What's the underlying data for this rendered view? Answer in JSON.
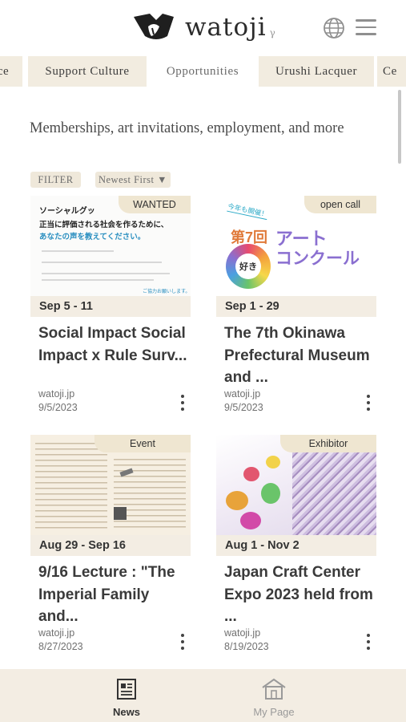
{
  "header": {
    "brand": "watoji",
    "brand_sup": "γ"
  },
  "tabs": [
    {
      "label": "ce"
    },
    {
      "label": "Support Culture"
    },
    {
      "label": "Opportunities"
    },
    {
      "label": "Urushi Lacquer"
    },
    {
      "label": "Ce"
    }
  ],
  "page": {
    "subtitle": "Memberships, art invitations, employment, and more"
  },
  "filters": {
    "filter_label": "FILTER",
    "sort_label": "Newest First ▼"
  },
  "cards": [
    {
      "badge": "WANTED",
      "date_range": "Sep 5 - 11",
      "title": "Social Impact Social Impact x Rule Surv...",
      "source": "watoji.jp",
      "date": "9/5/2023",
      "image_text": {
        "line1": "ソーシャルグッ",
        "line2": "正当に評価される社会を作るために、",
        "line3": "あなたの声を教えてください。",
        "footer": "ご協力お願いします。"
      }
    },
    {
      "badge": "open call",
      "date_range": "Sep 1 - 29",
      "title": "The 7th Okinawa Prefectural Museum and ...",
      "source": "watoji.jp",
      "date": "9/5/2023",
      "image_text": {
        "ribbon": "今年も開催！",
        "kai": "第7回",
        "art": "アート",
        "concours": "コンクール",
        "suki": "好き"
      }
    },
    {
      "badge": "Event",
      "date_range": "Aug 29 - Sep 16",
      "title": "9/16 Lecture : \"The Imperial Family and...",
      "source": "watoji.jp",
      "date": "8/27/2023"
    },
    {
      "badge": "Exhibitor",
      "date_range": "Aug 1 - Nov 2",
      "title": "Japan Craft Center Expo 2023 held from ...",
      "source": "watoji.jp",
      "date": "8/19/2023"
    }
  ],
  "bottom_nav": [
    {
      "label": "News",
      "icon": "newspaper-icon",
      "active": true
    },
    {
      "label": "My Page",
      "icon": "house-icon",
      "active": false
    }
  ],
  "colors": {
    "tab_bg": "#f2ece0",
    "badge_bg": "#efe6d1",
    "date_bar_bg": "#f3ede3",
    "nav_bg": "#f3ede3",
    "accent_purple": "#8a6fd0"
  }
}
